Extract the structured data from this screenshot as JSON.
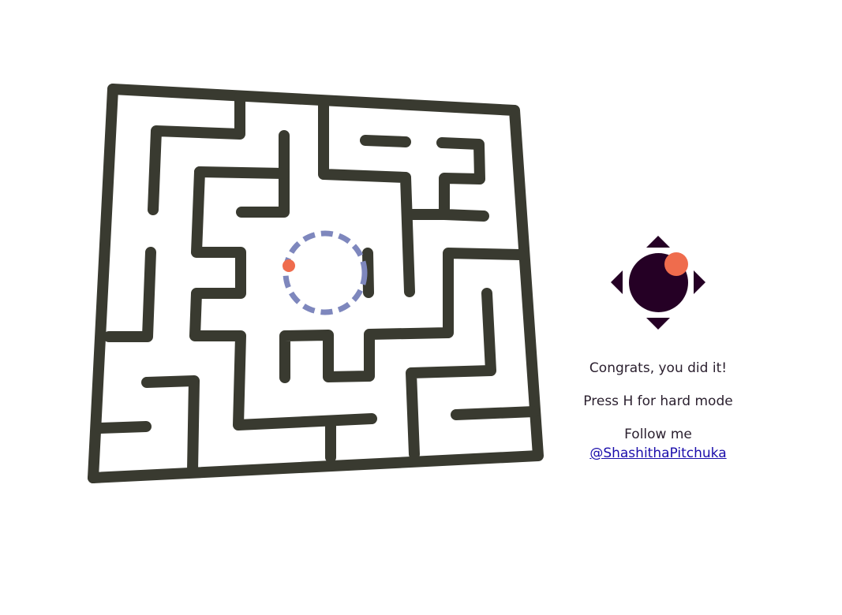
{
  "colors": {
    "wall": "#393a30",
    "goal_ring": "#7e87bd",
    "ball": "#ef6c4d",
    "joystick": "#250025",
    "text": "#2a1f2e",
    "link": "#1a0dab"
  },
  "game": {
    "state": "won",
    "status_text": "Congrats, you did it!",
    "hint_text": "Press H for hard mode",
    "follow_label": "Follow me",
    "follow_link": "@ShashithaPitchuka"
  },
  "controls": {
    "up_icon": "triangle-up-icon",
    "down_icon": "triangle-down-icon",
    "left_icon": "triangle-left-icon",
    "right_icon": "triangle-right-icon"
  }
}
